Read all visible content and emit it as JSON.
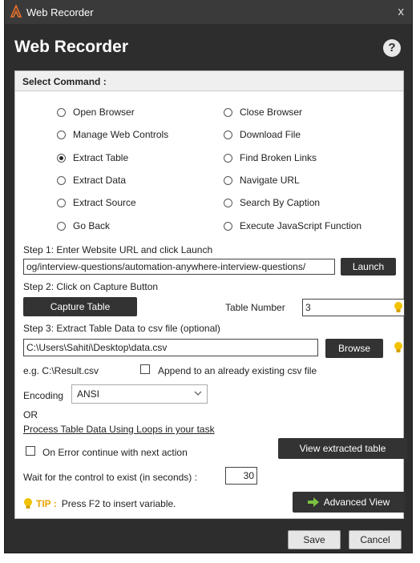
{
  "window": {
    "title": "Web Recorder",
    "close_glyph": "x"
  },
  "header": {
    "title": "Web Recorder",
    "help_glyph": "?"
  },
  "select_command": {
    "label": "Select Command :",
    "options_left": [
      "Open Browser",
      "Manage Web Controls",
      "Extract Table",
      "Extract Data",
      "Extract Source",
      "Go Back"
    ],
    "options_right": [
      "Close Browser",
      "Download File",
      "Find Broken Links",
      "Navigate URL",
      "Search By Caption",
      "Execute JavaScript Function"
    ],
    "selected": "Extract Table"
  },
  "step1": {
    "label": "Step 1: Enter Website URL and click Launch",
    "url_value": "og/interview-questions/automation-anywhere-interview-questions/",
    "launch_label": "Launch"
  },
  "step2": {
    "label": "Step 2: Click on Capture Button",
    "capture_label": "Capture Table",
    "table_number_label": "Table Number",
    "table_number_value": "3"
  },
  "step3": {
    "label": "Step 3: Extract Table Data to csv file (optional)",
    "path_value": "C:\\Users\\Sahiti\\Desktop\\data.csv",
    "browse_label": "Browse",
    "example": "e.g. C:\\Result.csv",
    "append_label": "Append to an already existing csv file",
    "append_checked": false
  },
  "encoding": {
    "label": "Encoding",
    "value": "ANSI"
  },
  "or_label": "OR",
  "loops_link": "Process Table Data Using Loops in your task",
  "on_error": {
    "label": "On Error continue with next action",
    "checked": false
  },
  "view_extracted_label": "View extracted table",
  "wait": {
    "label": "Wait for the control to exist (in seconds) :",
    "value": "30"
  },
  "tip": {
    "label": "TIP :",
    "text": "Press F2 to insert variable."
  },
  "advanced_view_label": "Advanced View",
  "footer": {
    "save_label": "Save",
    "cancel_label": "Cancel"
  },
  "colors": {
    "dark_bg": "#2d2d2d",
    "bulb": "#f2c200",
    "arrow": "#7cc242",
    "tip": "#e8a400"
  },
  "icons": [
    "app-icon",
    "close-icon",
    "help-icon",
    "lightbulb-icon",
    "chevron-down-icon",
    "arrow-right-icon"
  ]
}
